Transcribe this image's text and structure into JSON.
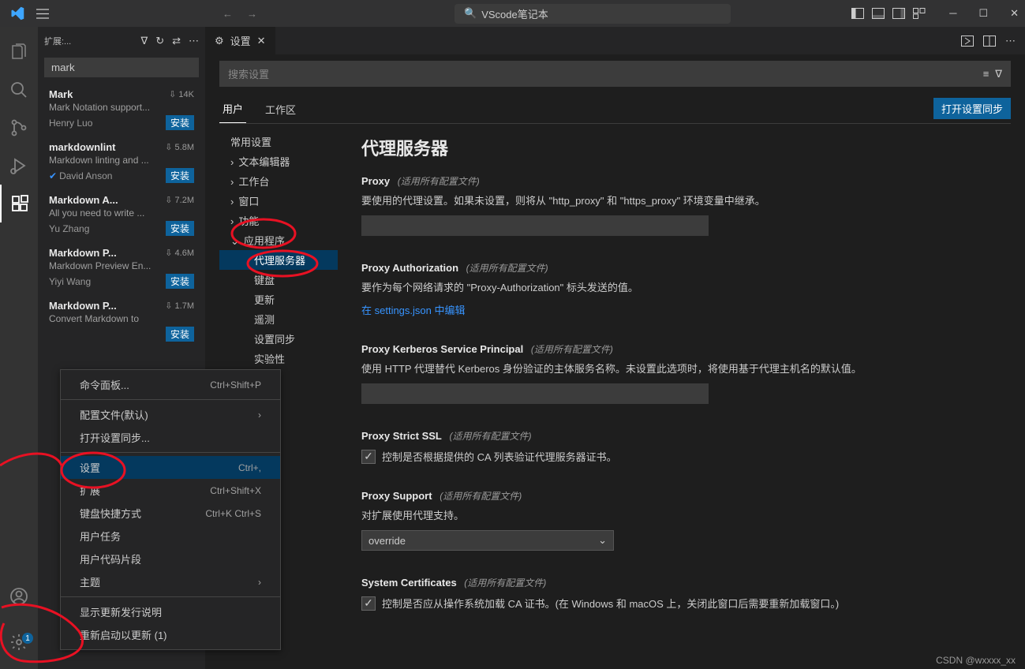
{
  "titlebar": {
    "search_label": "VScode笔记本"
  },
  "sidebar": {
    "title": "扩展:...",
    "search_value": "mark",
    "install_label": "安装",
    "extensions": [
      {
        "name": "Mark",
        "downloads": "14K",
        "desc": "Mark Notation support...",
        "author": "Henry Luo",
        "verified": false
      },
      {
        "name": "markdownlint",
        "downloads": "5.8M",
        "desc": "Markdown linting and ...",
        "author": "David Anson",
        "verified": true
      },
      {
        "name": "Markdown A...",
        "downloads": "7.2M",
        "desc": "All you need to write ...",
        "author": "Yu Zhang",
        "verified": false
      },
      {
        "name": "Markdown P...",
        "downloads": "4.6M",
        "desc": "Markdown Preview En...",
        "author": "Yiyi Wang",
        "verified": false
      },
      {
        "name": "Markdown P...",
        "downloads": "1.7M",
        "desc": "Convert Markdown to",
        "author": "",
        "verified": false
      }
    ]
  },
  "tabs": {
    "settings": "设置"
  },
  "settings": {
    "search_placeholder": "搜索设置",
    "scope_user": "用户",
    "scope_workspace": "工作区",
    "sync_button": "打开设置同步",
    "tree": {
      "common": "常用设置",
      "text_editor": "文本编辑器",
      "workbench": "工作台",
      "window": "窗口",
      "features": "功能",
      "application": "应用程序",
      "proxy": "代理服务器",
      "keyboard": "键盘",
      "update": "更新",
      "telemetry": "遥测",
      "settings_sync": "设置同步",
      "experimental": "实验性"
    },
    "heading": "代理服务器",
    "scope_text": "(适用所有配置文件)",
    "proxy": {
      "title": "Proxy",
      "desc": "要使用的代理设置。如果未设置，则将从 \"http_proxy\" 和 \"https_proxy\" 环境变量中继承。"
    },
    "proxy_auth": {
      "title": "Proxy Authorization",
      "desc": "要作为每个网络请求的 \"Proxy-Authorization\" 标头发送的值。",
      "link": "在 settings.json 中编辑"
    },
    "proxy_kerberos": {
      "title": "Proxy Kerberos Service Principal",
      "desc": "使用 HTTP 代理替代 Kerberos 身份验证的主体服务名称。未设置此选项时，将使用基于代理主机名的默认值。"
    },
    "proxy_ssl": {
      "title": "Proxy Strict SSL",
      "desc": "控制是否根据提供的 CA 列表验证代理服务器证书。"
    },
    "proxy_support": {
      "title": "Proxy Support",
      "desc": "对扩展使用代理支持。",
      "value": "override"
    },
    "system_certs": {
      "title": "System Certificates",
      "desc": "控制是否应从操作系统加载 CA 证书。(在 Windows 和 macOS 上，关闭此窗口后需要重新加载窗口。)"
    }
  },
  "context_menu": {
    "command_palette": "命令面板...",
    "command_palette_key": "Ctrl+Shift+P",
    "profiles": "配置文件(默认)",
    "open_settings_sync": "打开设置同步...",
    "settings": "设置",
    "settings_key": "Ctrl+,",
    "extensions": "扩展",
    "extensions_key": "Ctrl+Shift+X",
    "keyboard_shortcuts": "键盘快捷方式",
    "keyboard_shortcuts_key": "Ctrl+K Ctrl+S",
    "user_tasks": "用户任务",
    "user_snippets": "用户代码片段",
    "themes": "主题",
    "show_release_notes": "显示更新发行说明",
    "restart_to_update": "重新启动以更新 (1)"
  },
  "gear_badge": "1",
  "watermark": "CSDN @wxxxx_xx"
}
